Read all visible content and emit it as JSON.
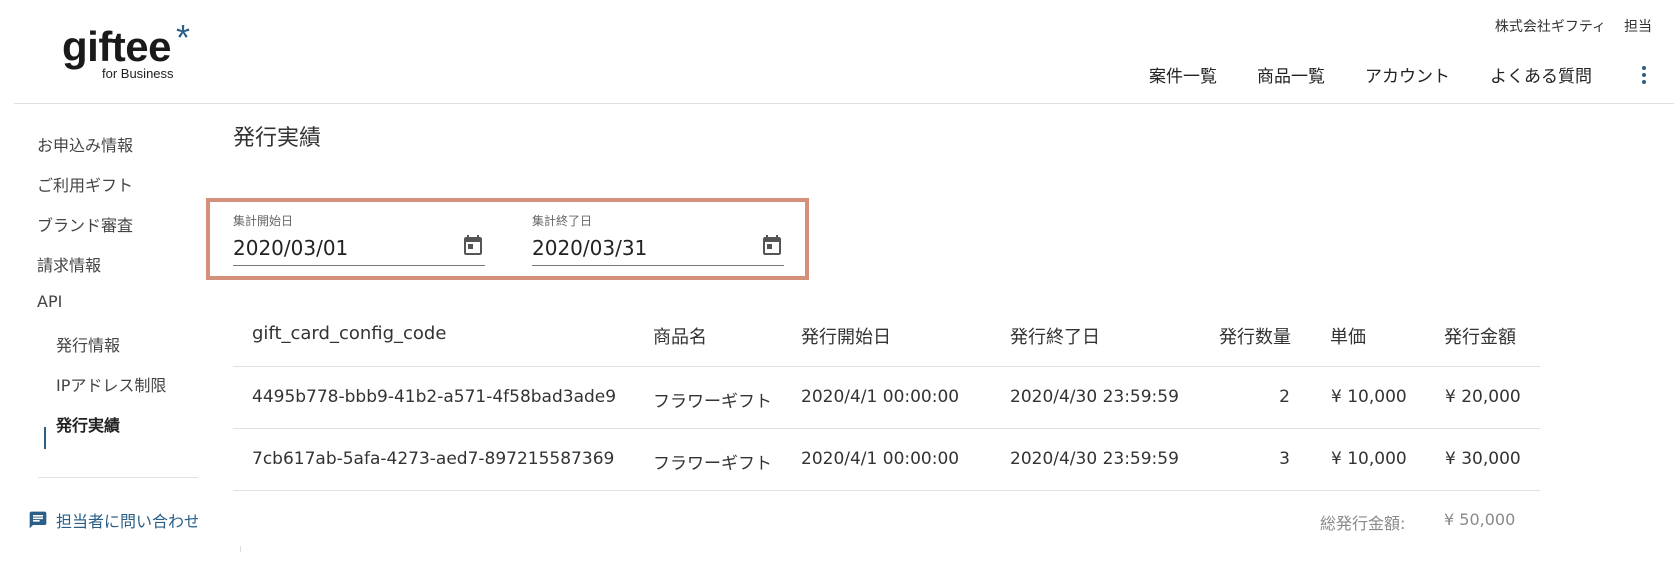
{
  "logo": {
    "main": "giftee",
    "star": "*",
    "sub": "for Business"
  },
  "header": {
    "company": "株式会社ギフティ",
    "user": "担当",
    "nav": [
      "案件一覧",
      "商品一覧",
      "アカウント",
      "よくある質問"
    ]
  },
  "sidebar": {
    "items": [
      "お申込み情報",
      "ご利用ギフト",
      "ブランド審査",
      "請求情報",
      "API"
    ],
    "sub_items": [
      "発行情報",
      "IPアドレス制限",
      "発行実績"
    ],
    "active": "発行実績",
    "contact": "担当者に問い合わせ"
  },
  "page": {
    "title": "発行実績"
  },
  "date_range": {
    "start_label": "集計開始日",
    "start_value": "2020/03/01",
    "end_label": "集計終了日",
    "end_value": "2020/03/31"
  },
  "table": {
    "headers": [
      "gift_card_config_code",
      "商品名",
      "発行開始日",
      "発行終了日",
      "発行数量",
      "単価",
      "発行金額"
    ],
    "rows": [
      [
        "4495b778-bbb9-41b2-a571-4f58bad3ade9",
        "フラワーギフト",
        "2020/4/1 00:00:00",
        "2020/4/30 23:59:59",
        "2",
        "¥ 10,000",
        "¥ 20,000"
      ],
      [
        "7cb617ab-5afa-4273-aed7-897215587369",
        "フラワーギフト",
        "2020/4/1 00:00:00",
        "2020/4/30 23:59:59",
        "3",
        "¥ 10,000",
        "¥ 30,000"
      ]
    ]
  },
  "total": {
    "label": "総発行金額:",
    "value": "¥ 50,000"
  },
  "colors": {
    "accent": "#2b5f87",
    "highlight_border": "#d4907a"
  }
}
